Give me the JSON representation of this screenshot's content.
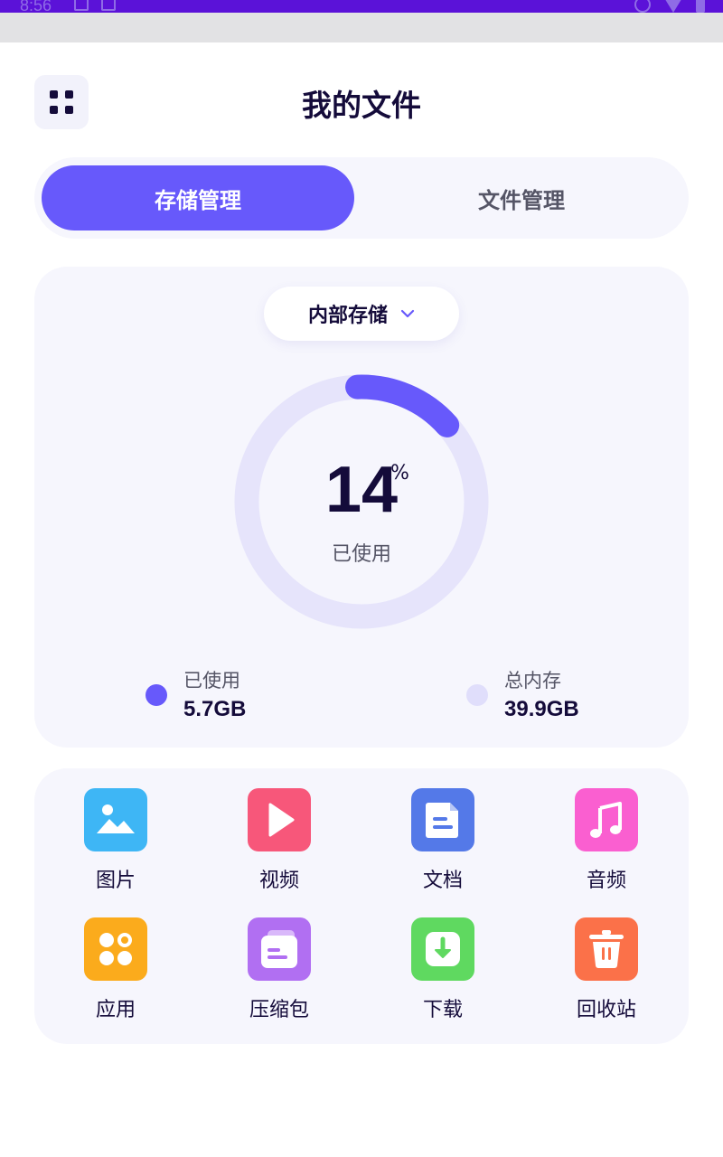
{
  "status_bar": {
    "time": "8:56"
  },
  "header": {
    "title": "我的文件",
    "menu_icon": "grid-icon"
  },
  "tabs": [
    {
      "label": "存储管理",
      "active": true
    },
    {
      "label": "文件管理",
      "active": false
    }
  ],
  "storage": {
    "selector_label": "内部存储",
    "used_percent": 14,
    "percent_sign": "%",
    "caption": "已使用",
    "used_label": "已使用",
    "used_value": "5.7GB",
    "total_label": "总内存",
    "total_value": "39.9GB",
    "colors": {
      "used": "#6759fb",
      "track": "#e6e4fb",
      "total_dot": "#e0defb"
    }
  },
  "categories": [
    {
      "label": "图片",
      "icon": "image-icon",
      "color": "#3eb6f5"
    },
    {
      "label": "视频",
      "icon": "video-icon",
      "color": "#f7577a"
    },
    {
      "label": "文档",
      "icon": "document-icon",
      "color": "#5479e8"
    },
    {
      "label": "音频",
      "icon": "music-icon",
      "color": "#fa5fd0"
    },
    {
      "label": "应用",
      "icon": "apps-icon",
      "color": "#fbab1c"
    },
    {
      "label": "压缩包",
      "icon": "archive-icon",
      "color": "#b16ff2"
    },
    {
      "label": "下载",
      "icon": "download-icon",
      "color": "#5fd960"
    },
    {
      "label": "回收站",
      "icon": "trash-icon",
      "color": "#fb7149"
    }
  ]
}
